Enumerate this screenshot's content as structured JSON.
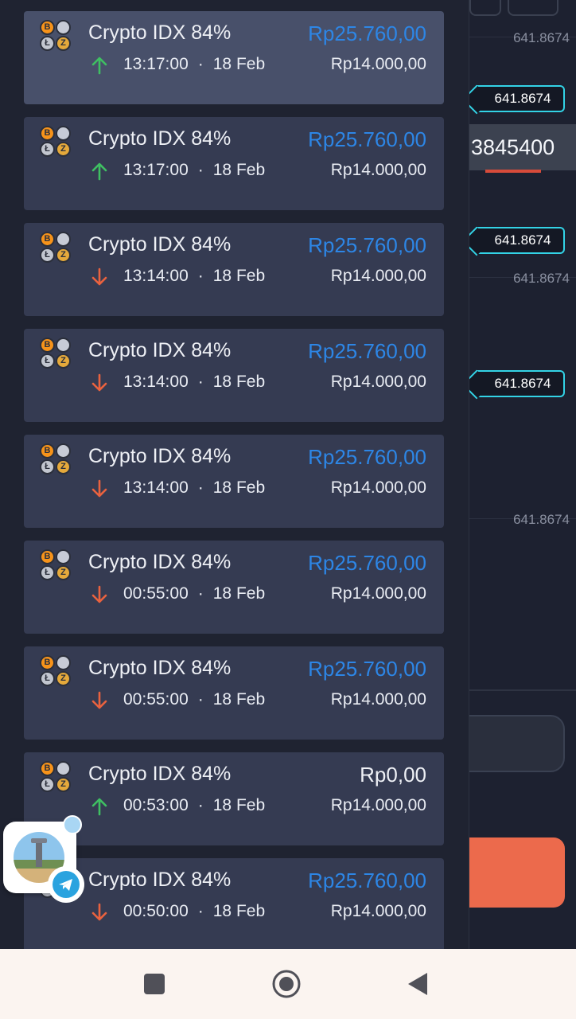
{
  "chart": {
    "price_labels": [
      "641.8674",
      "641.8674",
      "641.8674"
    ],
    "price_tags": [
      "641.8674",
      "641.8674",
      "641.8674"
    ],
    "big_quote": "3845400",
    "colors": {
      "tag_border": "#33d3e6",
      "sell": "#ec6a4c"
    }
  },
  "history": {
    "items": [
      {
        "asset": "Crypto IDX 84%",
        "payout": "Rp25.760,00",
        "direction": "up",
        "time": "13:17:00",
        "date": "18 Feb",
        "amount": "Rp14.000,00"
      },
      {
        "asset": "Crypto IDX 84%",
        "payout": "Rp25.760,00",
        "direction": "up",
        "time": "13:17:00",
        "date": "18 Feb",
        "amount": "Rp14.000,00"
      },
      {
        "asset": "Crypto IDX 84%",
        "payout": "Rp25.760,00",
        "direction": "down",
        "time": "13:14:00",
        "date": "18 Feb",
        "amount": "Rp14.000,00"
      },
      {
        "asset": "Crypto IDX 84%",
        "payout": "Rp25.760,00",
        "direction": "down",
        "time": "13:14:00",
        "date": "18 Feb",
        "amount": "Rp14.000,00"
      },
      {
        "asset": "Crypto IDX 84%",
        "payout": "Rp25.760,00",
        "direction": "down",
        "time": "13:14:00",
        "date": "18 Feb",
        "amount": "Rp14.000,00"
      },
      {
        "asset": "Crypto IDX 84%",
        "payout": "Rp25.760,00",
        "direction": "down",
        "time": "00:55:00",
        "date": "18 Feb",
        "amount": "Rp14.000,00"
      },
      {
        "asset": "Crypto IDX 84%",
        "payout": "Rp25.760,00",
        "direction": "down",
        "time": "00:55:00",
        "date": "18 Feb",
        "amount": "Rp14.000,00"
      },
      {
        "asset": "Crypto IDX 84%",
        "payout": "Rp0,00",
        "direction": "up",
        "time": "00:53:00",
        "date": "18 Feb",
        "amount": "Rp14.000,00"
      },
      {
        "asset": "Crypto IDX 84%",
        "payout": "Rp25.760,00",
        "direction": "down",
        "time": "00:50:00",
        "date": "18 Feb",
        "amount": "Rp14.000,00"
      }
    ],
    "colors": {
      "payout_win": "#2d86e6",
      "up": "#3fbf62",
      "down": "#e9623f"
    }
  },
  "navbar": {
    "buttons": [
      "recents-icon",
      "home-icon",
      "back-icon"
    ]
  }
}
